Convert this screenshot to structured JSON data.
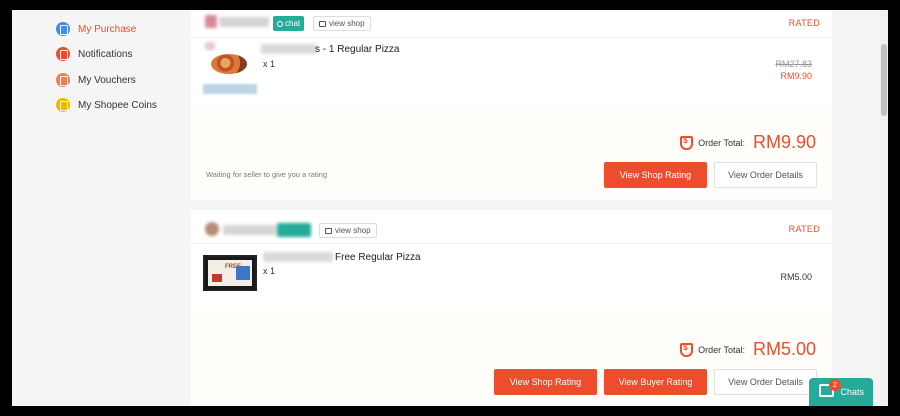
{
  "sidebar": {
    "items": [
      {
        "label": "My Purchase",
        "icon": "clipboard-icon",
        "color": "#3f8ee8",
        "active": true
      },
      {
        "label": "Notifications",
        "icon": "bell-icon",
        "color": "#ee4d2d",
        "active": false
      },
      {
        "label": "My Vouchers",
        "icon": "voucher-icon",
        "color": "#f07d55",
        "active": false
      },
      {
        "label": "My Shopee Coins",
        "icon": "coin-icon",
        "color": "#f6b500",
        "active": false
      }
    ]
  },
  "orders": [
    {
      "chat_label": "chat",
      "view_shop_label": "view shop",
      "status": "RATED",
      "product_name": "s - 1 Regular Pizza",
      "quantity": "x 1",
      "price_original": "RM27.83",
      "price": "RM9.90",
      "total_label": "Order Total:",
      "total": "RM9.90",
      "waiting_text": "Waiting for seller to give you a rating",
      "buttons": {
        "view_shop_rating": "View Shop Rating",
        "view_order_details": "View Order Details"
      }
    },
    {
      "view_shop_label": "view shop",
      "status": "RATED",
      "product_name": "Free Regular Pizza",
      "quantity": "x 1",
      "price": "RM5.00",
      "thumb_text": "FREE",
      "total_label": "Order Total:",
      "total": "RM5.00",
      "buttons": {
        "view_shop_rating": "View Shop Rating",
        "view_buyer_rating": "View Buyer Rating",
        "view_order_details": "View Order Details"
      }
    }
  ],
  "chats": {
    "label": "Chats",
    "badge": "2"
  },
  "colors": {
    "accent": "#ee4d2d",
    "teal": "#26aa99"
  }
}
